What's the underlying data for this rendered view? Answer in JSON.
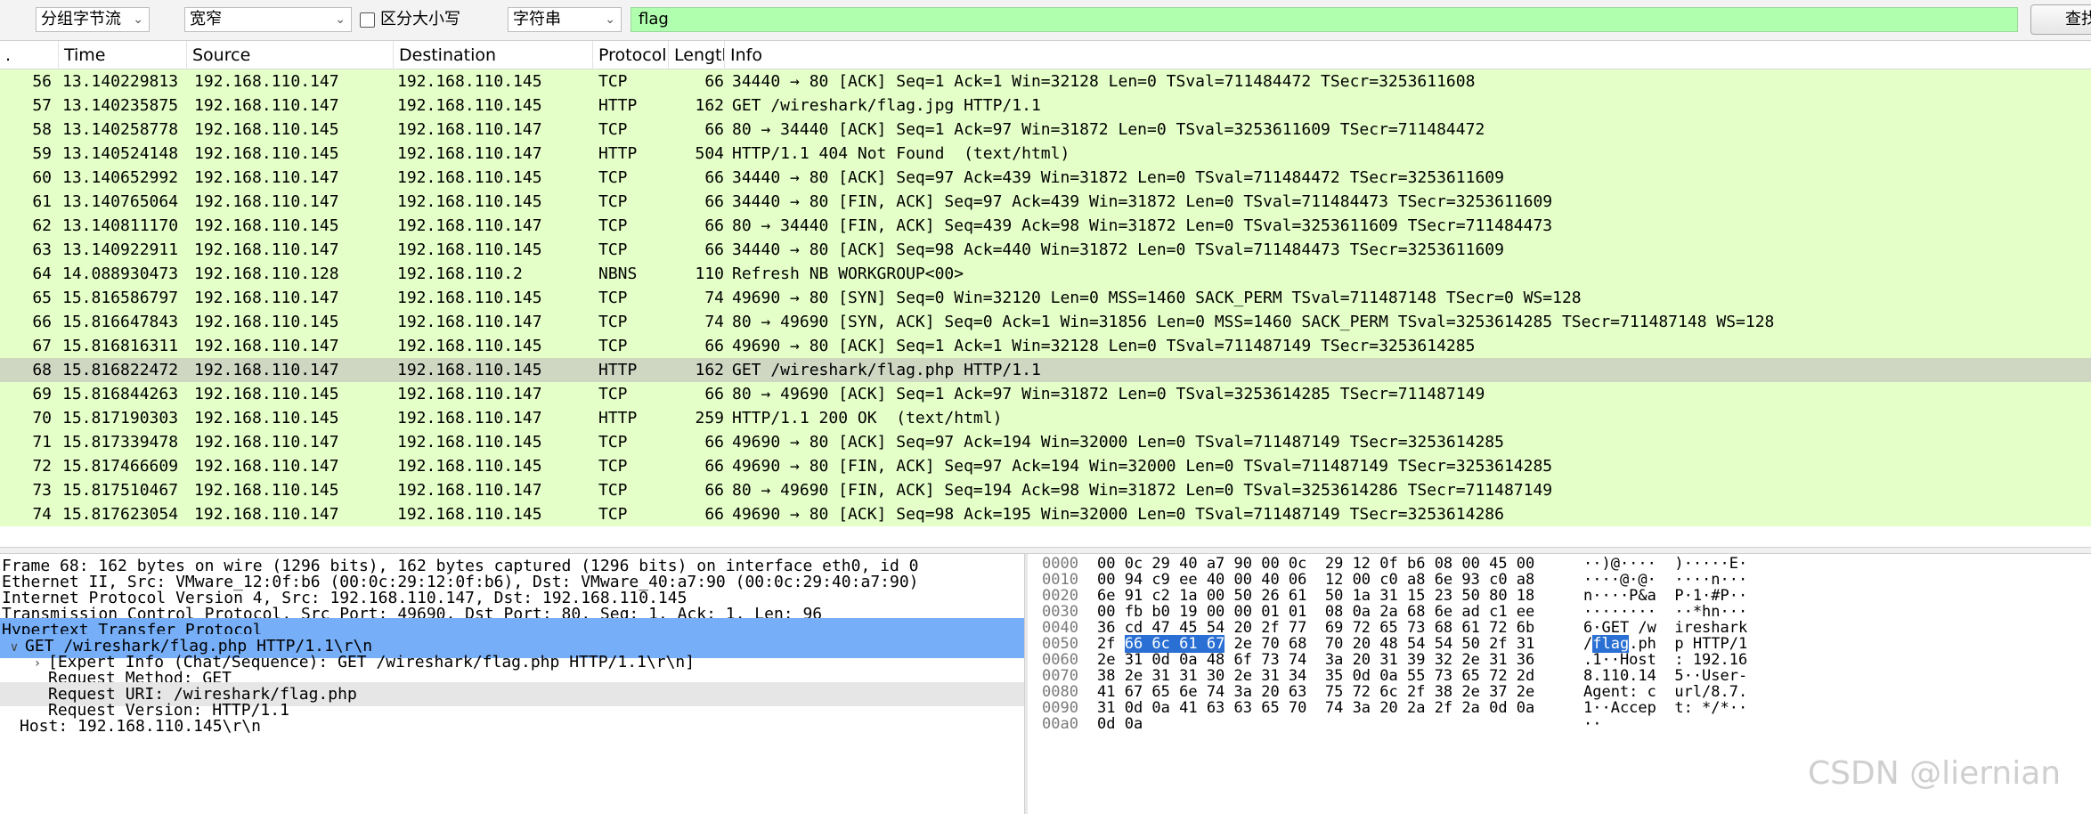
{
  "toolbar": {
    "mode_select": "分组字节流",
    "width_select": "宽窄",
    "case_label": "区分大小写",
    "type_select": "字符串",
    "search_value": "flag",
    "find_button": "查找"
  },
  "columns": [
    ".",
    "Time",
    "Source",
    "Destination",
    "Protocol",
    "Length",
    "Info"
  ],
  "packets": [
    {
      "no": "56",
      "time": "13.140229813",
      "src": "192.168.110.147",
      "dst": "192.168.110.145",
      "proto": "TCP",
      "len": "66",
      "info": "34440 → 80 [ACK] Seq=1 Ack=1 Win=32128 Len=0 TSval=711484472 TSecr=3253611608"
    },
    {
      "no": "57",
      "time": "13.140235875",
      "src": "192.168.110.147",
      "dst": "192.168.110.145",
      "proto": "HTTP",
      "len": "162",
      "info": "GET /wireshark/flag.jpg HTTP/1.1"
    },
    {
      "no": "58",
      "time": "13.140258778",
      "src": "192.168.110.145",
      "dst": "192.168.110.147",
      "proto": "TCP",
      "len": "66",
      "info": "80 → 34440 [ACK] Seq=1 Ack=97 Win=31872 Len=0 TSval=3253611609 TSecr=711484472"
    },
    {
      "no": "59",
      "time": "13.140524148",
      "src": "192.168.110.145",
      "dst": "192.168.110.147",
      "proto": "HTTP",
      "len": "504",
      "info": "HTTP/1.1 404 Not Found  (text/html)"
    },
    {
      "no": "60",
      "time": "13.140652992",
      "src": "192.168.110.147",
      "dst": "192.168.110.145",
      "proto": "TCP",
      "len": "66",
      "info": "34440 → 80 [ACK] Seq=97 Ack=439 Win=31872 Len=0 TSval=711484472 TSecr=3253611609"
    },
    {
      "no": "61",
      "time": "13.140765064",
      "src": "192.168.110.147",
      "dst": "192.168.110.145",
      "proto": "TCP",
      "len": "66",
      "info": "34440 → 80 [FIN, ACK] Seq=97 Ack=439 Win=31872 Len=0 TSval=711484473 TSecr=3253611609"
    },
    {
      "no": "62",
      "time": "13.140811170",
      "src": "192.168.110.145",
      "dst": "192.168.110.147",
      "proto": "TCP",
      "len": "66",
      "info": "80 → 34440 [FIN, ACK] Seq=439 Ack=98 Win=31872 Len=0 TSval=3253611609 TSecr=711484473"
    },
    {
      "no": "63",
      "time": "13.140922911",
      "src": "192.168.110.147",
      "dst": "192.168.110.145",
      "proto": "TCP",
      "len": "66",
      "info": "34440 → 80 [ACK] Seq=98 Ack=440 Win=31872 Len=0 TSval=711484473 TSecr=3253611609"
    },
    {
      "no": "64",
      "time": "14.088930473",
      "src": "192.168.110.128",
      "dst": "192.168.110.2",
      "proto": "NBNS",
      "len": "110",
      "info": "Refresh NB WORKGROUP<00>"
    },
    {
      "no": "65",
      "time": "15.816586797",
      "src": "192.168.110.147",
      "dst": "192.168.110.145",
      "proto": "TCP",
      "len": "74",
      "info": "49690 → 80 [SYN] Seq=0 Win=32120 Len=0 MSS=1460 SACK_PERM TSval=711487148 TSecr=0 WS=128"
    },
    {
      "no": "66",
      "time": "15.816647843",
      "src": "192.168.110.145",
      "dst": "192.168.110.147",
      "proto": "TCP",
      "len": "74",
      "info": "80 → 49690 [SYN, ACK] Seq=0 Ack=1 Win=31856 Len=0 MSS=1460 SACK_PERM TSval=3253614285 TSecr=711487148 WS=128"
    },
    {
      "no": "67",
      "time": "15.816816311",
      "src": "192.168.110.147",
      "dst": "192.168.110.145",
      "proto": "TCP",
      "len": "66",
      "info": "49690 → 80 [ACK] Seq=1 Ack=1 Win=32128 Len=0 TSval=711487149 TSecr=3253614285"
    },
    {
      "no": "68",
      "time": "15.816822472",
      "src": "192.168.110.147",
      "dst": "192.168.110.145",
      "proto": "HTTP",
      "len": "162",
      "info": "GET /wireshark/flag.php HTTP/1.1",
      "selected": true
    },
    {
      "no": "69",
      "time": "15.816844263",
      "src": "192.168.110.145",
      "dst": "192.168.110.147",
      "proto": "TCP",
      "len": "66",
      "info": "80 → 49690 [ACK] Seq=1 Ack=97 Win=31872 Len=0 TSval=3253614285 TSecr=711487149"
    },
    {
      "no": "70",
      "time": "15.817190303",
      "src": "192.168.110.145",
      "dst": "192.168.110.147",
      "proto": "HTTP",
      "len": "259",
      "info": "HTTP/1.1 200 OK  (text/html)"
    },
    {
      "no": "71",
      "time": "15.817339478",
      "src": "192.168.110.147",
      "dst": "192.168.110.145",
      "proto": "TCP",
      "len": "66",
      "info": "49690 → 80 [ACK] Seq=97 Ack=194 Win=32000 Len=0 TSval=711487149 TSecr=3253614285"
    },
    {
      "no": "72",
      "time": "15.817466609",
      "src": "192.168.110.147",
      "dst": "192.168.110.145",
      "proto": "TCP",
      "len": "66",
      "info": "49690 → 80 [FIN, ACK] Seq=97 Ack=194 Win=32000 Len=0 TSval=711487149 TSecr=3253614285"
    },
    {
      "no": "73",
      "time": "15.817510467",
      "src": "192.168.110.145",
      "dst": "192.168.110.147",
      "proto": "TCP",
      "len": "66",
      "info": "80 → 49690 [FIN, ACK] Seq=194 Ack=98 Win=31872 Len=0 TSval=3253614286 TSecr=711487149"
    },
    {
      "no": "74",
      "time": "15.817623054",
      "src": "192.168.110.147",
      "dst": "192.168.110.145",
      "proto": "TCP",
      "len": "66",
      "info": "49690 → 80 [ACK] Seq=98 Ack=195 Win=32000 Len=0 TSval=711487149 TSecr=3253614286"
    }
  ],
  "details": [
    {
      "expander": "",
      "text": "Frame 68: 162 bytes on wire (1296 bits), 162 bytes captured (1296 bits) on interface eth0, id 0",
      "style": ""
    },
    {
      "expander": "",
      "text": "Ethernet II, Src: VMware_12:0f:b6 (00:0c:29:12:0f:b6), Dst: VMware_40:a7:90 (00:0c:29:40:a7:90)",
      "style": ""
    },
    {
      "expander": "",
      "text": "Internet Protocol Version 4, Src: 192.168.110.147, Dst: 192.168.110.145",
      "style": ""
    },
    {
      "expander": "",
      "text": "Transmission Control Protocol, Src Port: 49690, Dst Port: 80, Seq: 1, Ack: 1, Len: 96",
      "style": ""
    },
    {
      "expander": "",
      "text": "Hypertext Transfer Protocol",
      "style": "sel"
    },
    {
      "expander": "∨",
      "text": "GET /wireshark/flag.php HTTP/1.1\\r\\n",
      "style": "sel",
      "indent": 0
    },
    {
      "expander": "›",
      "text": "[Expert Info (Chat/Sequence): GET /wireshark/flag.php HTTP/1.1\\r\\n]",
      "style": "",
      "indent": 1
    },
    {
      "expander": "",
      "text": "Request Method: GET",
      "style": "",
      "indent": 1
    },
    {
      "expander": "",
      "text": "Request URI: /wireshark/flag.php",
      "style": "hl",
      "indent": 1
    },
    {
      "expander": "",
      "text": "Request Version: HTTP/1.1",
      "style": "",
      "indent": 1
    },
    {
      "expander": "",
      "text": "Host: 192.168.110.145\\r\\n",
      "style": "",
      "indent": 0
    }
  ],
  "hex_rows": [
    {
      "offset": "0000",
      "bytes": "00 0c 29 40 a7 90 00 0c  29 12 0f b6 08 00 45 00",
      "ascii": "··)@····  )·····E·"
    },
    {
      "offset": "0010",
      "bytes": "00 94 c9 ee 40 00 40 06  12 00 c0 a8 6e 93 c0 a8",
      "ascii": "····@·@·  ····n···"
    },
    {
      "offset": "0020",
      "bytes": "6e 91 c2 1a 00 50 26 61  50 1a 31 15 23 50 80 18",
      "ascii": "n····P&a  P·1·#P··"
    },
    {
      "offset": "0030",
      "bytes": "00 fb b0 19 00 00 01 01  08 0a 2a 68 6e ad c1 ee",
      "ascii": "········  ··*hn···"
    },
    {
      "offset": "0040",
      "bytes": "36 cd 47 45 54 20 2f 77  69 72 65 73 68 61 72 6b",
      "ascii": "6·GET /w  ireshark"
    },
    {
      "offset": "0050",
      "bytes_pre": "2f ",
      "bytes_hl": "66 6c 61 67",
      "bytes_post": " 2e 70 68  70 20 48 54 54 50 2f 31",
      "ascii_pre": "/",
      "ascii_hl": "flag",
      "ascii_post": ".ph  p HTTP/1"
    },
    {
      "offset": "0060",
      "bytes": "2e 31 0d 0a 48 6f 73 74  3a 20 31 39 32 2e 31 36",
      "ascii": ".1··Host  : 192.16"
    },
    {
      "offset": "0070",
      "bytes": "38 2e 31 31 30 2e 31 34  35 0d 0a 55 73 65 72 2d",
      "ascii": "8.110.14  5··User-"
    },
    {
      "offset": "0080",
      "bytes": "41 67 65 6e 74 3a 20 63  75 72 6c 2f 38 2e 37 2e",
      "ascii": "Agent: c  url/8.7."
    },
    {
      "offset": "0090",
      "bytes": "31 0d 0a 41 63 63 65 70  74 3a 20 2a 2f 2a 0d 0a",
      "ascii": "1··Accep  t: */*··"
    },
    {
      "offset": "00a0",
      "bytes": "0d 0a",
      "ascii": "··"
    }
  ],
  "watermark": "CSDN @liernian",
  "colors": {
    "row_tcp_http": "#e4ffc7",
    "row_selected": "#cfd7c3",
    "filter_bg": "#afffaf",
    "detail_selected": "#76aef8",
    "hex_highlight": "#2a6fd3"
  },
  "icons": {
    "dropdown": "chevron-down-icon",
    "expand": "chevron-right-icon",
    "collapse": "chevron-down-icon"
  }
}
